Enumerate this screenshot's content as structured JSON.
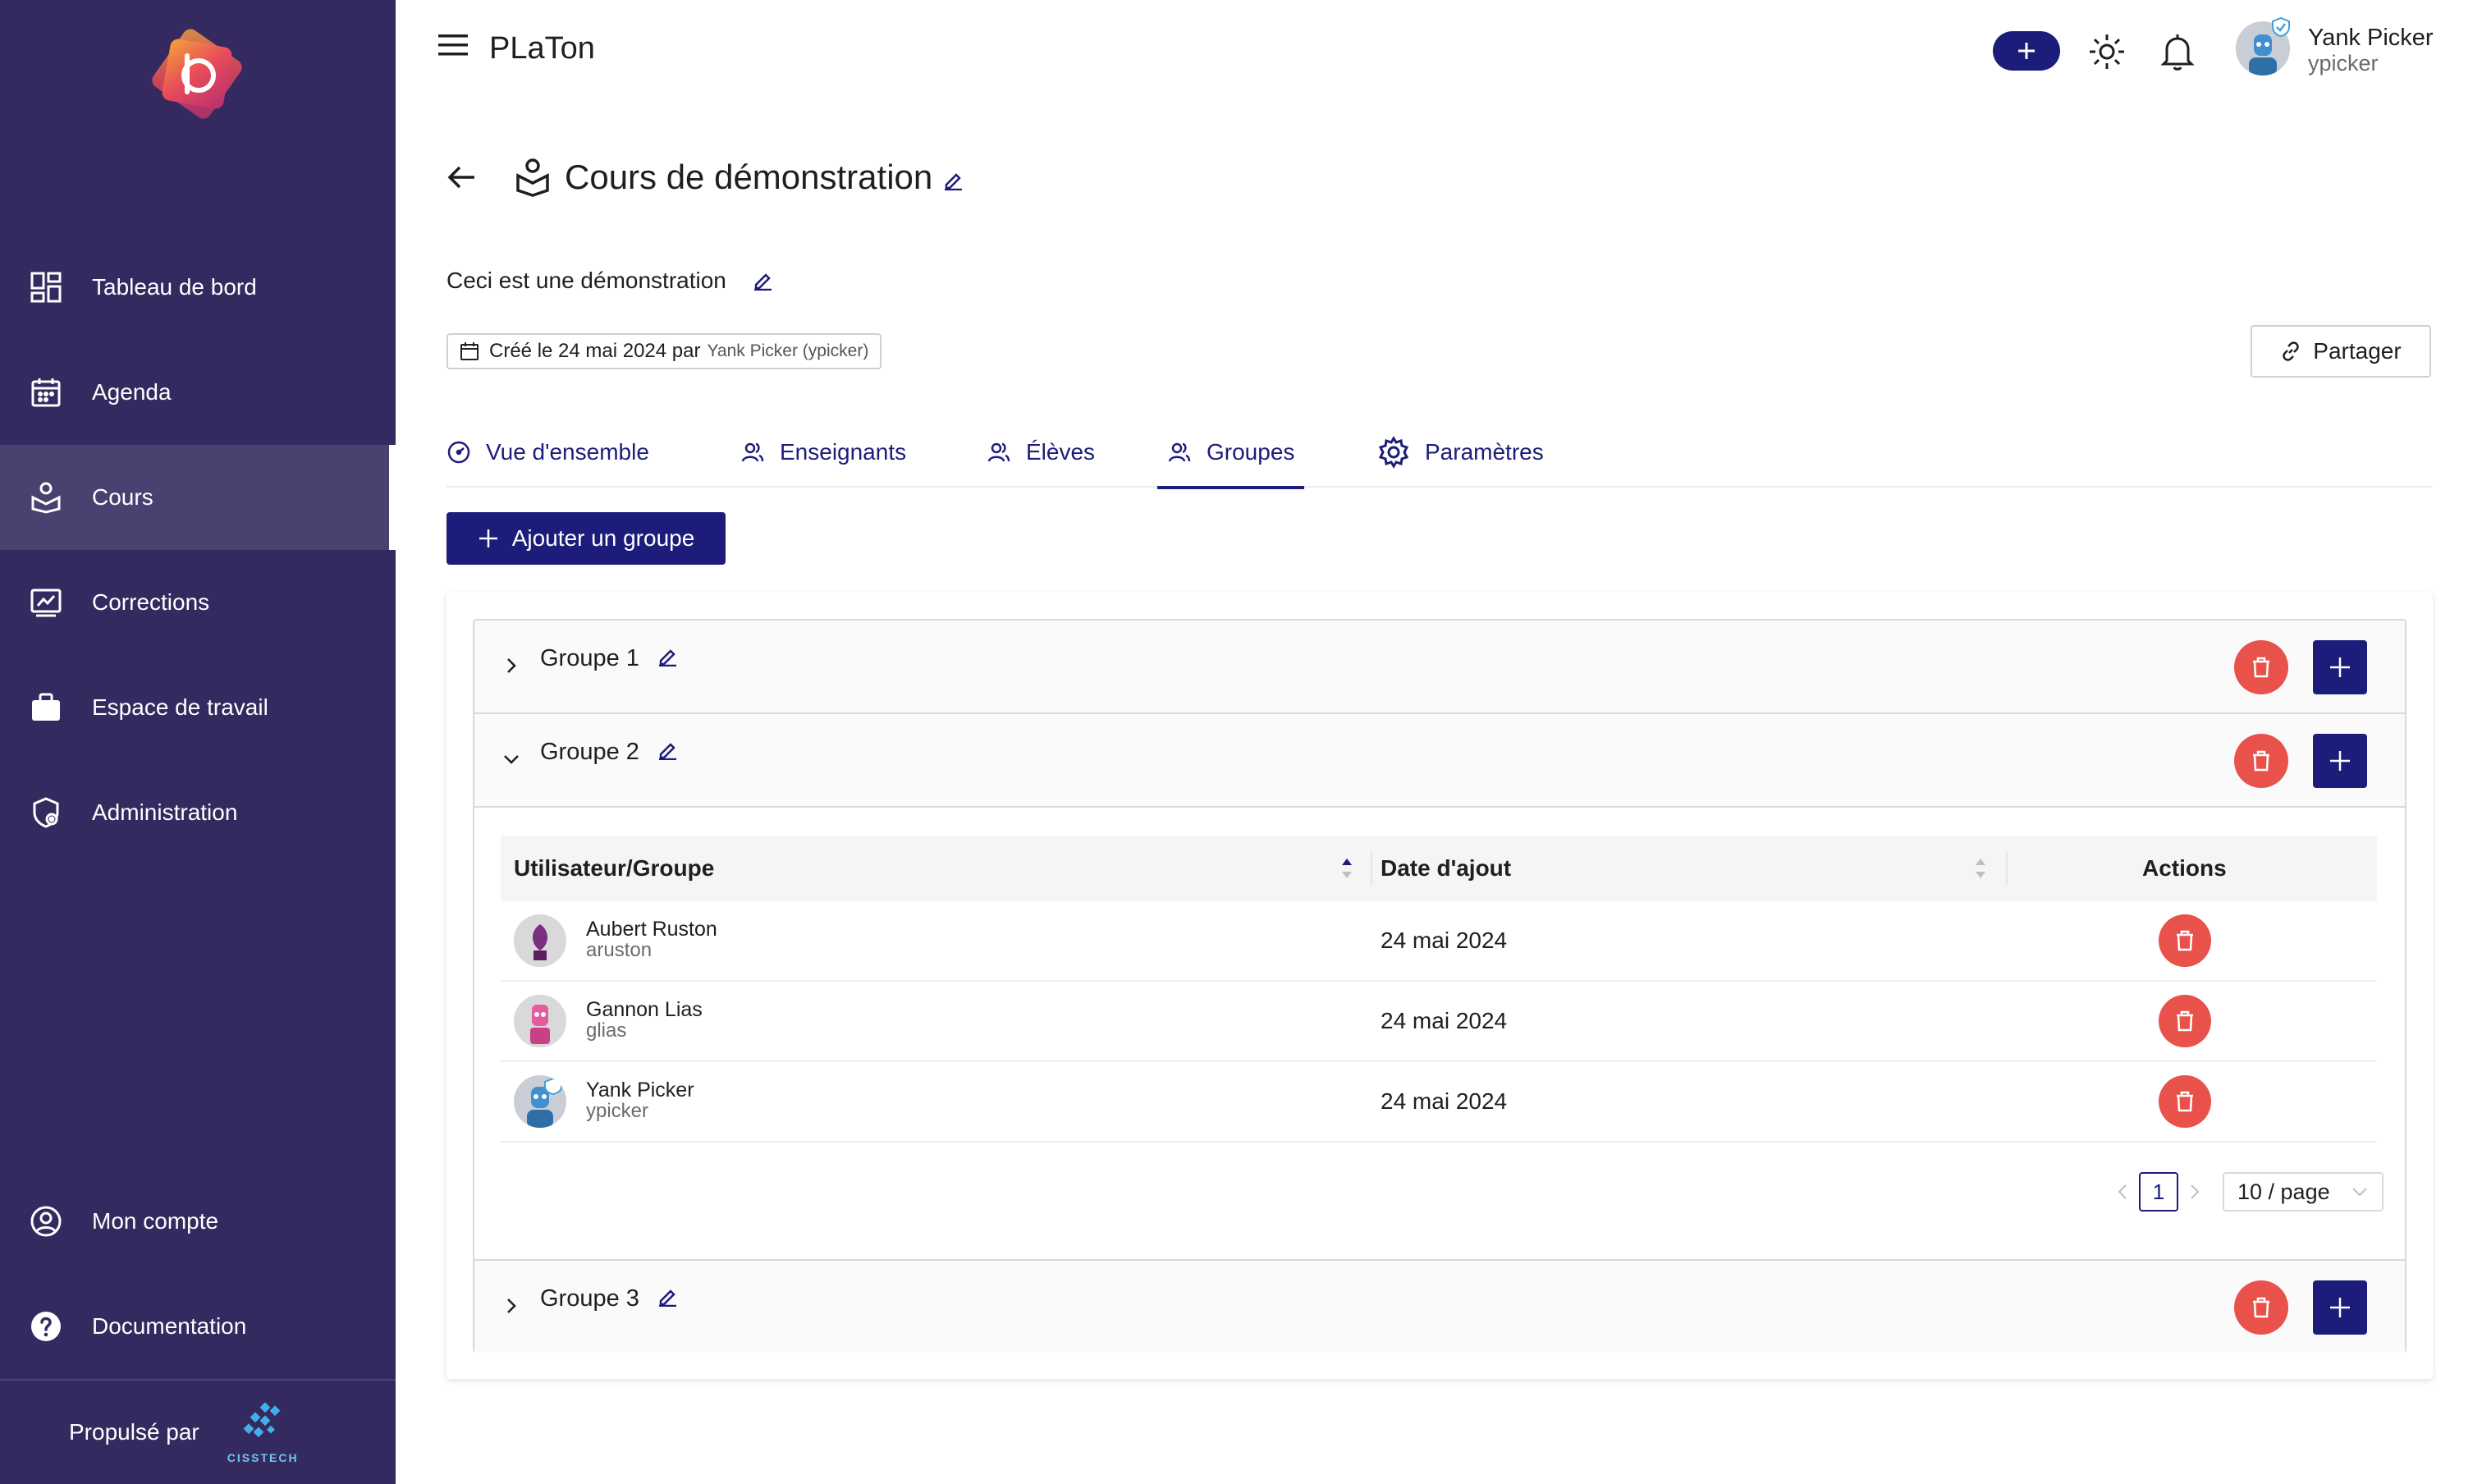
{
  "app": {
    "title": "PLaTon"
  },
  "header": {
    "user": {
      "name": "Yank Picker",
      "login": "ypicker"
    }
  },
  "sidebar": {
    "items": [
      {
        "label": "Tableau de bord",
        "icon": "dashboard-icon"
      },
      {
        "label": "Agenda",
        "icon": "calendar-icon"
      },
      {
        "label": "Cours",
        "icon": "course-icon",
        "active": true
      },
      {
        "label": "Corrections",
        "icon": "corrections-icon"
      },
      {
        "label": "Espace de travail",
        "icon": "briefcase-icon"
      },
      {
        "label": "Administration",
        "icon": "admin-shield-icon"
      },
      {
        "label": "Mon compte",
        "icon": "account-icon"
      },
      {
        "label": "Documentation",
        "icon": "help-icon"
      }
    ],
    "footer": {
      "powered_by": "Propulsé par",
      "brand": "CISSTECH"
    }
  },
  "course": {
    "title": "Cours de démonstration",
    "description": "Ceci est une démonstration",
    "created_prefix": "Créé le 24 mai 2024 par",
    "created_by": "Yank Picker (ypicker)",
    "share_label": "Partager"
  },
  "tabs": [
    {
      "label": "Vue d'ensemble",
      "icon": "dashboard-gauge-icon"
    },
    {
      "label": "Enseignants",
      "icon": "users-icon"
    },
    {
      "label": "Élèves",
      "icon": "users-icon"
    },
    {
      "label": "Groupes",
      "icon": "users-icon",
      "active": true
    },
    {
      "label": "Paramètres",
      "icon": "gear-icon"
    }
  ],
  "add_group_label": "Ajouter un groupe",
  "groups": [
    {
      "label": "Groupe 1",
      "expanded": false
    },
    {
      "label": "Groupe 2",
      "expanded": true
    },
    {
      "label": "Groupe 3",
      "expanded": false
    }
  ],
  "table": {
    "columns": [
      "Utilisateur/Groupe",
      "Date d'ajout",
      "Actions"
    ],
    "rows": [
      {
        "name": "Aubert Ruston",
        "login": "aruston",
        "date": "24 mai 2024"
      },
      {
        "name": "Gannon Lias",
        "login": "glias",
        "date": "24 mai 2024"
      },
      {
        "name": "Yank Picker",
        "login": "ypicker",
        "date": "24 mai 2024"
      }
    ]
  },
  "pagination": {
    "current_page": "1",
    "page_size": "10 / page"
  },
  "colors": {
    "sidebar": "#352a5f",
    "primary": "#1c1c7a",
    "danger": "#e8524a"
  }
}
